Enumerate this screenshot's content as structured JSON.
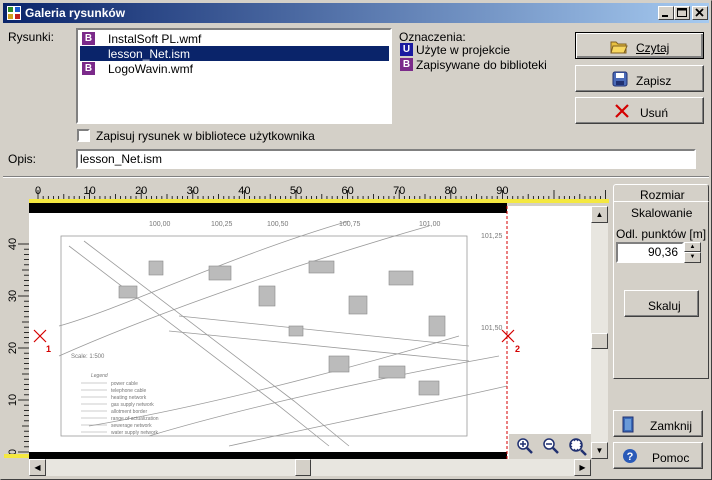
{
  "window": {
    "title": "Galeria rysunków"
  },
  "drawings": {
    "label": "Rysunki:",
    "items": [
      {
        "name": "InstalSoft PL.wmf",
        "badge": "B",
        "selected": false
      },
      {
        "name": "lesson_Net.ism",
        "badge": "",
        "selected": true
      },
      {
        "name": "LogoWavin.wmf",
        "badge": "B",
        "selected": false
      }
    ]
  },
  "legend": {
    "title": "Oznaczenia:",
    "items": [
      {
        "badge": "U",
        "text": "Użyte w projekcie"
      },
      {
        "badge": "B",
        "text": "Zapisywane do biblioteki"
      }
    ]
  },
  "buttons": {
    "read": "Czytaj",
    "save": "Zapisz",
    "delete": "Usuń",
    "close": "Zamknij",
    "help": "Pomoc",
    "scale": "Skaluj"
  },
  "checkbox": {
    "label": "Zapisuj rysunek w bibliotece użytkownika",
    "checked": false
  },
  "description": {
    "label": "Opis:",
    "value": "lesson_Net.ism"
  },
  "side_panel": {
    "tab_size": "Rozmiar",
    "tab_scaling": "Skalowanie",
    "distance_label": "Odl. punktów [m]",
    "distance_value": "90,36"
  },
  "ruler": {
    "h_ticks": [
      "0",
      "10",
      "20",
      "30",
      "40",
      "50",
      "60",
      "70",
      "80",
      "90"
    ],
    "v_ticks": [
      "40",
      "30",
      "20",
      "10",
      "0"
    ]
  },
  "markers": {
    "point1": "1",
    "point2": "2"
  },
  "map_labels": {
    "elevations": [
      "100,00",
      "100,25",
      "100,50",
      "100,75",
      "101,00",
      "101,25",
      "101,50"
    ],
    "scale_text": "Scale: 1:500",
    "legend_title": "Legend",
    "legend_items": [
      "power cable",
      "telephone cable",
      "heating network",
      "gas supply network",
      "allotment border",
      "range of actualization",
      "sewerage network",
      "water supply network"
    ]
  },
  "colors": {
    "title_start": "#0a246a",
    "title_end": "#a6caf0",
    "selection": "#0a246a",
    "badge_b": "#7b2a8a",
    "badge_u": "#1a1aa0",
    "marker": "#d40000"
  }
}
